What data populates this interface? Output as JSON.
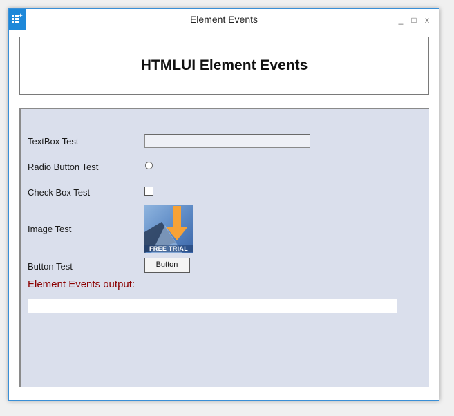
{
  "window": {
    "title": "Element Events",
    "controls": {
      "minimize": "_",
      "maximize": "□",
      "close": "x"
    },
    "accent": "#1e88d9"
  },
  "header": {
    "title": "HTMLUI Element Events"
  },
  "form": {
    "textbox_label": "TextBox Test",
    "textbox_value": "",
    "radio_label": "Radio Button Test",
    "checkbox_label": "Check Box Test",
    "image_label": "Image Test",
    "image_caption": "FREE TRIAL",
    "button_label": "Button Test",
    "button_text": "Button"
  },
  "output": {
    "label": "Element Events output:",
    "value": "",
    "label_color": "#8b0000"
  },
  "colors": {
    "panel_background": "#dadfec"
  }
}
